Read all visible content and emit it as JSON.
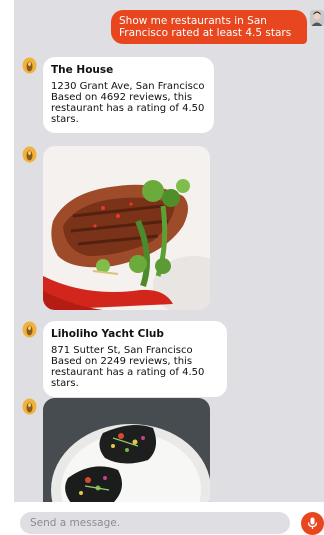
{
  "user_message": {
    "text": "Show me restaurants in San Francisco rated at least 4.5 stars"
  },
  "results": [
    {
      "name": "The House",
      "description": "1230 Grant Ave, San Francisco Based on 4692 reviews, this restaurant has a rating of 4.50 stars."
    },
    {
      "name": "Liholiho Yacht Club",
      "description": "871 Sutter St, San Francisco Based on 2249 reviews, this restaurant has a rating of 4.50 stars."
    }
  ],
  "composer": {
    "placeholder": "Send a message."
  },
  "colors": {
    "accent": "#e8461f",
    "chat_background": "#dfdfe3"
  },
  "icons": {
    "user_avatar": "user-avatar-icon",
    "bot_avatar": "bot-avatar-icon",
    "mic": "microphone-icon"
  }
}
